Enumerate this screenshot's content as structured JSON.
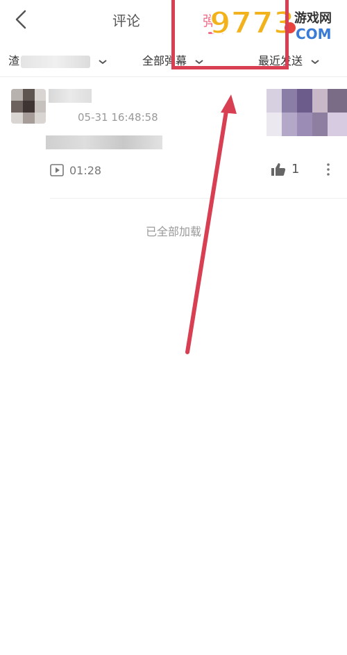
{
  "header": {
    "back_icon": "chevron-left-icon",
    "tabs": [
      {
        "label": "评论",
        "active": false
      },
      {
        "label": "弹",
        "active": true
      }
    ],
    "accent_color": "#f26b8a"
  },
  "watermark": {
    "text": "9773",
    "subtext": "游戏网",
    "suffix": "COM"
  },
  "filters": {
    "user_prefix": "渣",
    "type_label": "全部弹幕",
    "sort_label": "最近发送",
    "chevron_icon": "chevron-down-icon"
  },
  "danmaku_item": {
    "timestamp": "05-31 16:48:58",
    "play_time": "01:28",
    "like_count": "1",
    "play_icon": "play-icon",
    "like_icon": "thumbs-up-icon",
    "more_icon": "more-vertical-icon"
  },
  "footer_status": "已全部加载",
  "annotation": {
    "box_color": "#d93f52",
    "arrow_color": "#d93f52"
  }
}
